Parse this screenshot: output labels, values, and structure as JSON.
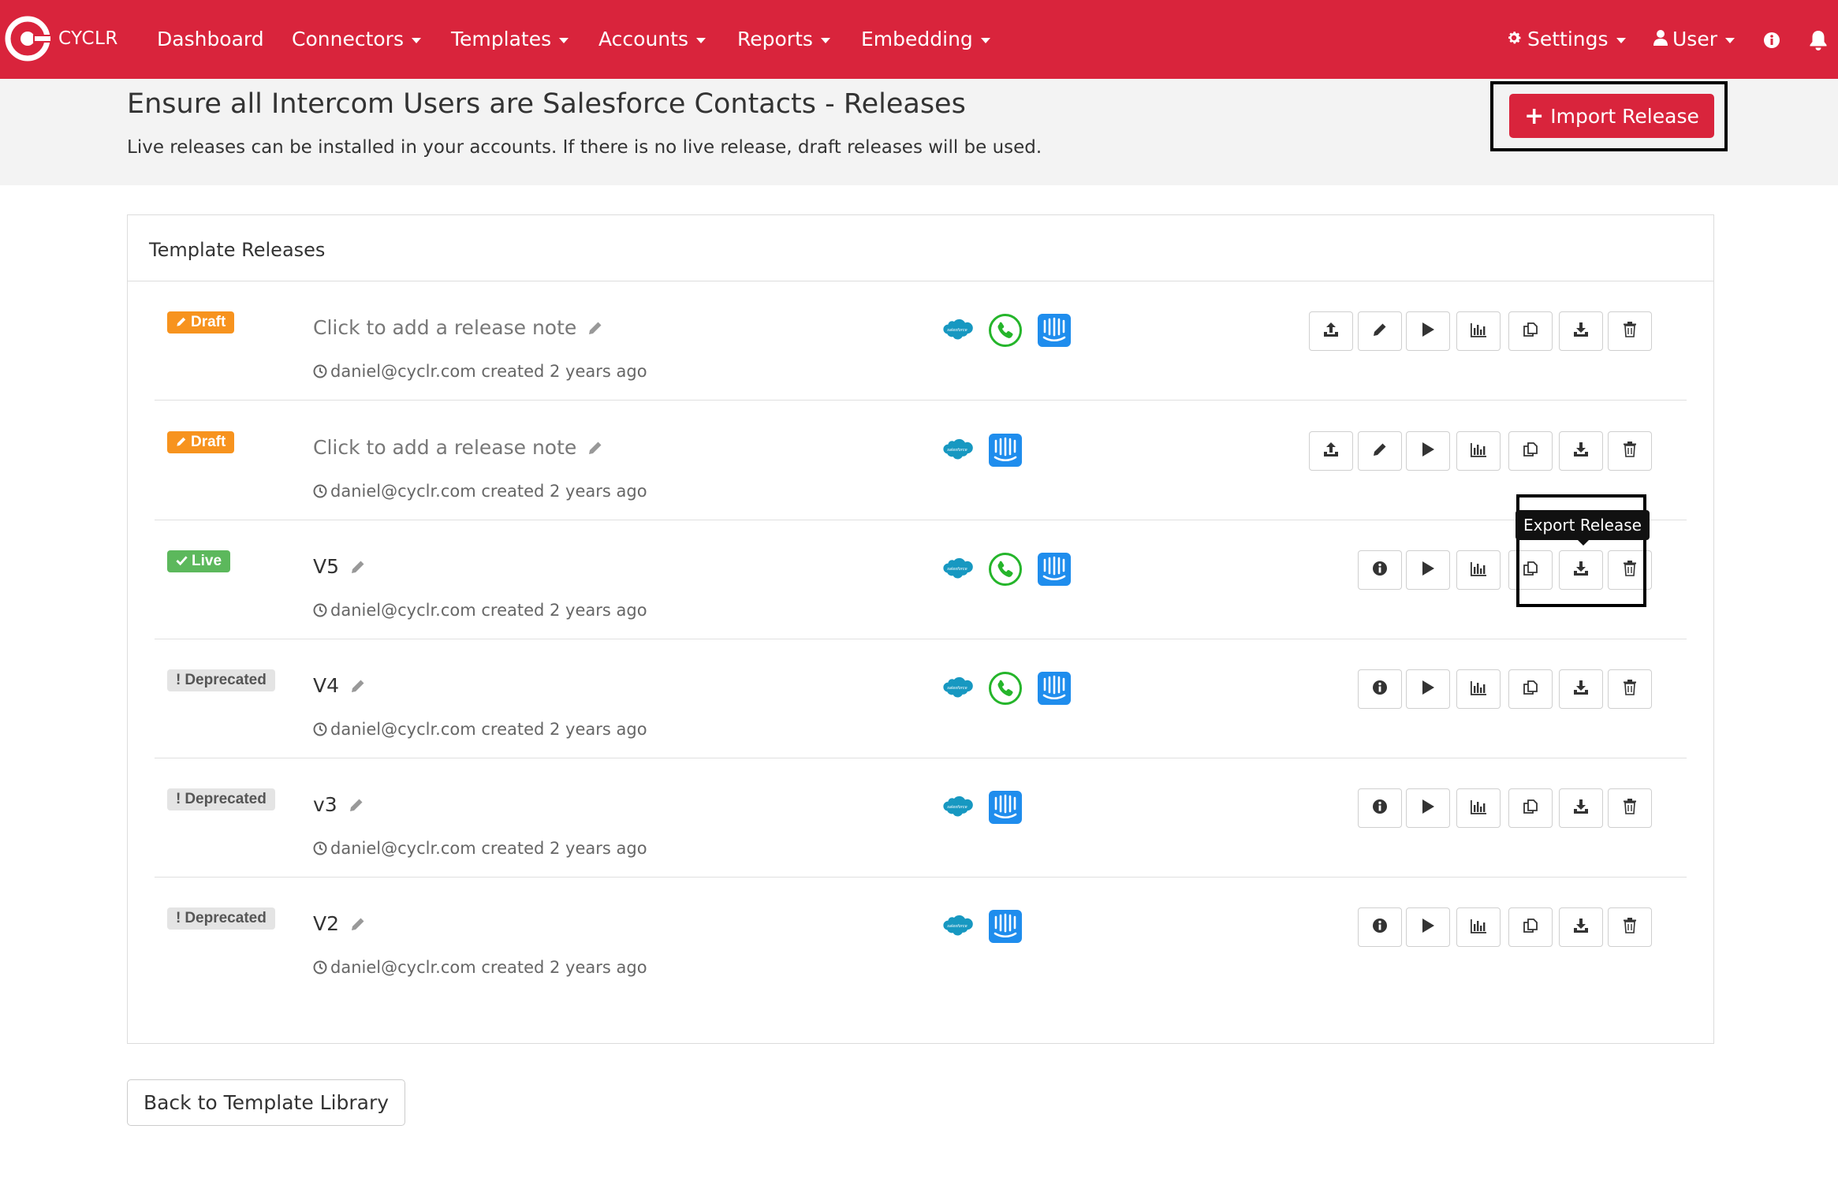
{
  "app": {
    "brand": "CYCLR",
    "brand_color": "#d9243c"
  },
  "nav": {
    "items": [
      {
        "label": "Dashboard",
        "dropdown": false
      },
      {
        "label": "Connectors",
        "dropdown": true
      },
      {
        "label": "Templates",
        "dropdown": true
      },
      {
        "label": "Accounts",
        "dropdown": true
      },
      {
        "label": "Reports",
        "dropdown": true
      },
      {
        "label": "Embedding",
        "dropdown": true
      }
    ],
    "right": {
      "settings_label": "Settings",
      "user_label": "User",
      "info_icon": "info-circle-icon",
      "bell_icon": "bell-icon"
    }
  },
  "header": {
    "title": "Ensure all Intercom Users are Salesforce Contacts - Releases",
    "subtitle": "Live releases can be installed in your accounts. If there is no live release, draft releases will be used.",
    "import_button_label": "Import Release"
  },
  "panel": {
    "title": "Template Releases",
    "releases": [
      {
        "status": "Draft",
        "name": "Click to add a release note",
        "is_placeholder": true,
        "meta": "daniel@cyclr.com created 2 years ago",
        "connectors": [
          "salesforce",
          "phone",
          "intercom"
        ],
        "actions": [
          "publish",
          "edit",
          "run",
          "stats",
          "copy",
          "export",
          "delete"
        ]
      },
      {
        "status": "Draft",
        "name": "Click to add a release note",
        "is_placeholder": true,
        "meta": "daniel@cyclr.com created 2 years ago",
        "connectors": [
          "salesforce",
          "intercom"
        ],
        "actions": [
          "publish",
          "edit",
          "run",
          "stats",
          "copy",
          "export",
          "delete"
        ]
      },
      {
        "status": "Live",
        "name": "V5",
        "is_placeholder": false,
        "meta": "daniel@cyclr.com created 2 years ago",
        "connectors": [
          "salesforce",
          "phone",
          "intercom"
        ],
        "actions": [
          "info",
          "run",
          "stats",
          "copy",
          "export",
          "delete"
        ]
      },
      {
        "status": "Deprecated",
        "name": "V4",
        "is_placeholder": false,
        "meta": "daniel@cyclr.com created 2 years ago",
        "connectors": [
          "salesforce",
          "phone",
          "intercom"
        ],
        "actions": [
          "info",
          "run",
          "stats",
          "copy",
          "export",
          "delete"
        ]
      },
      {
        "status": "Deprecated",
        "name": "v3",
        "is_placeholder": false,
        "meta": "daniel@cyclr.com created 2 years ago",
        "connectors": [
          "salesforce",
          "intercom"
        ],
        "actions": [
          "info",
          "run",
          "stats",
          "copy",
          "export",
          "delete"
        ]
      },
      {
        "status": "Deprecated",
        "name": "V2",
        "is_placeholder": false,
        "meta": "daniel@cyclr.com created 2 years ago",
        "connectors": [
          "salesforce",
          "intercom"
        ],
        "actions": [
          "info",
          "run",
          "stats",
          "copy",
          "export",
          "delete"
        ]
      }
    ]
  },
  "tooltip": {
    "text": "Export Release"
  },
  "footer": {
    "back_button_label": "Back to Template Library"
  },
  "colors": {
    "draft": "#f7931e",
    "live": "#5cb85c",
    "deprecated": "#e4e4e4",
    "salesforce": "#1798c1",
    "phone": "#25b52b",
    "intercom": "#1f8ded"
  }
}
